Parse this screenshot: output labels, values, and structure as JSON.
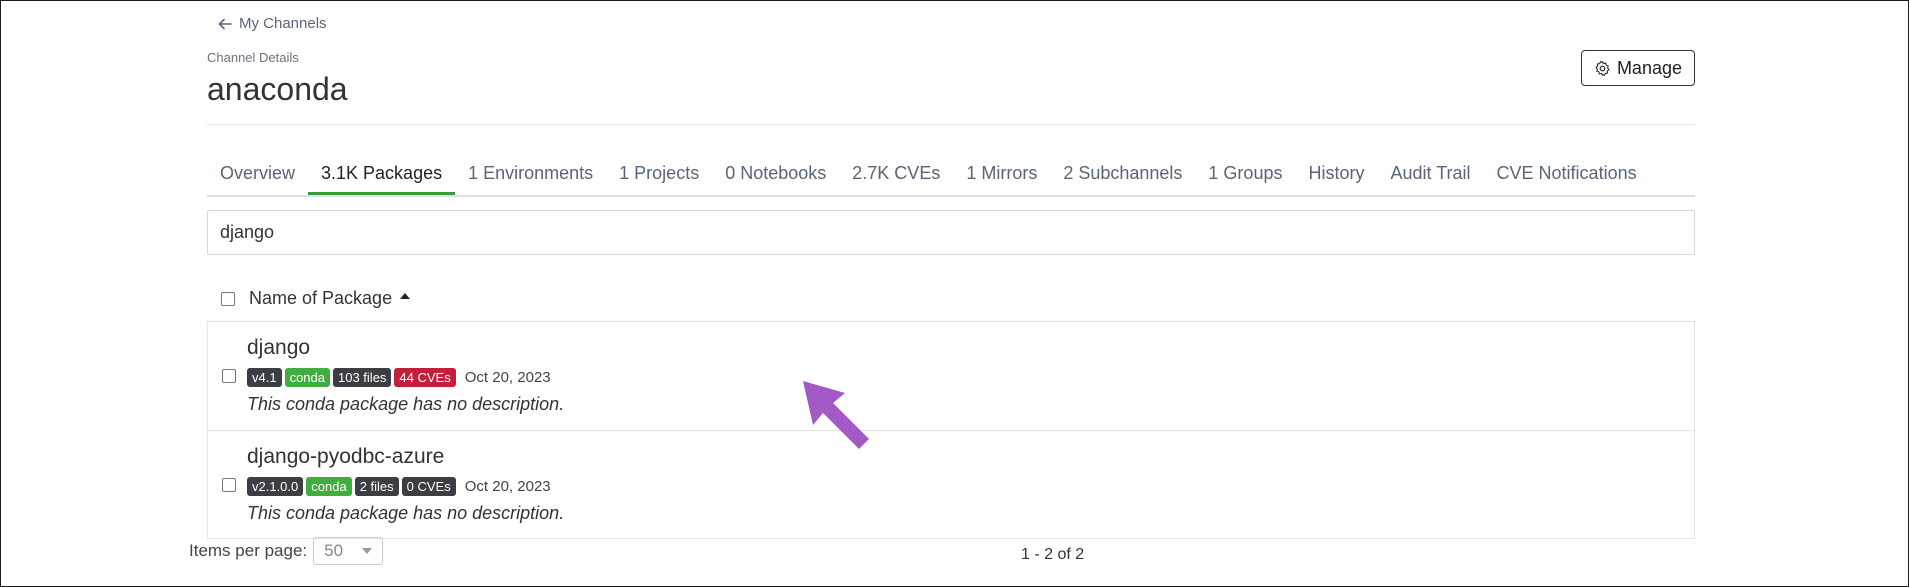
{
  "nav": {
    "back_label": "My Channels"
  },
  "header": {
    "overline": "Channel Details",
    "title": "anaconda",
    "manage_label": "Manage"
  },
  "tabs": [
    {
      "label": "Overview",
      "active": false
    },
    {
      "label": "3.1K Packages",
      "active": true
    },
    {
      "label": "1 Environments",
      "active": false
    },
    {
      "label": "1 Projects",
      "active": false
    },
    {
      "label": "0 Notebooks",
      "active": false
    },
    {
      "label": "2.7K CVEs",
      "active": false
    },
    {
      "label": "1 Mirrors",
      "active": false
    },
    {
      "label": "2 Subchannels",
      "active": false
    },
    {
      "label": "1 Groups",
      "active": false
    },
    {
      "label": "History",
      "active": false
    },
    {
      "label": "Audit Trail",
      "active": false
    },
    {
      "label": "CVE Notifications",
      "active": false
    }
  ],
  "search": {
    "value": "django"
  },
  "list": {
    "header_label": "Name of Package",
    "packages": [
      {
        "name": "django",
        "version": "v4.1",
        "type": "conda",
        "files": "103 files",
        "cves": "44 CVEs",
        "date": "Oct 20, 2023",
        "description": "This conda package has no description."
      },
      {
        "name": "django-pyodbc-azure",
        "version": "v2.1.0.0",
        "type": "conda",
        "files": "2 files",
        "cves": "0 CVEs",
        "date": "Oct 20, 2023",
        "description": "This conda package has no description."
      }
    ]
  },
  "pagination": {
    "items_per_page_label": "Items per page:",
    "items_per_page_value": "50",
    "range": "1 - 2 of 2"
  },
  "colors": {
    "accent": "#3a9a3a",
    "cve_alert": "#c41e3a",
    "conda_badge": "#3fae3f",
    "annotation_arrow": "#a259c6"
  }
}
